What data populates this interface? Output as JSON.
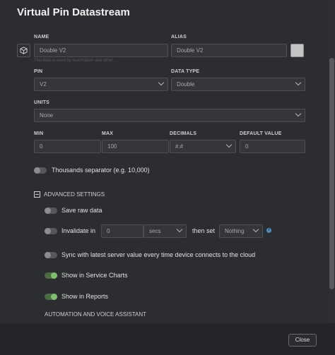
{
  "dialog": {
    "title": "Virtual Pin Datastream",
    "close_label": "Close"
  },
  "form": {
    "name": {
      "label": "NAME",
      "value": "Double V2"
    },
    "alias": {
      "label": "ALIAS",
      "value": "Double V2"
    },
    "hint": "This field is used by Automation and other ...",
    "pin": {
      "label": "PIN",
      "value": "V2"
    },
    "data_type": {
      "label": "DATA TYPE",
      "value": "Double"
    },
    "units": {
      "label": "UNITS",
      "value": "None"
    },
    "min": {
      "label": "MIN",
      "value": "0"
    },
    "max": {
      "label": "MAX",
      "value": "100"
    },
    "decimals": {
      "label": "DECIMALS",
      "value": "#.#"
    },
    "default_value": {
      "label": "DEFAULT VALUE",
      "value": "0"
    },
    "thousands_separator": {
      "label": "Thousands separator (e.g. 10,000)",
      "on": false
    }
  },
  "advanced": {
    "title": "ADVANCED SETTINGS",
    "save_raw": {
      "label": "Save raw data",
      "on": false
    },
    "invalidate": {
      "label": "Invalidate in",
      "value": "0",
      "unit": "secs",
      "then_set_label": "then set",
      "then_set_value": "Nothing",
      "on": false
    },
    "sync": {
      "label": "Sync with latest server value every time device connects to the cloud",
      "on": false
    },
    "service_charts": {
      "label": "Show in Service Charts",
      "on": true
    },
    "reports": {
      "label": "Show in Reports",
      "on": true
    },
    "automation_heading": "AUTOMATION AND VOICE ASSISTANT"
  },
  "icons": {
    "datastream": "cube-icon",
    "info": "info-icon"
  },
  "colors": {
    "toggle_on": "#7fbf6a",
    "info": "#4d8fc7",
    "swatch": "#c4c4c4"
  }
}
